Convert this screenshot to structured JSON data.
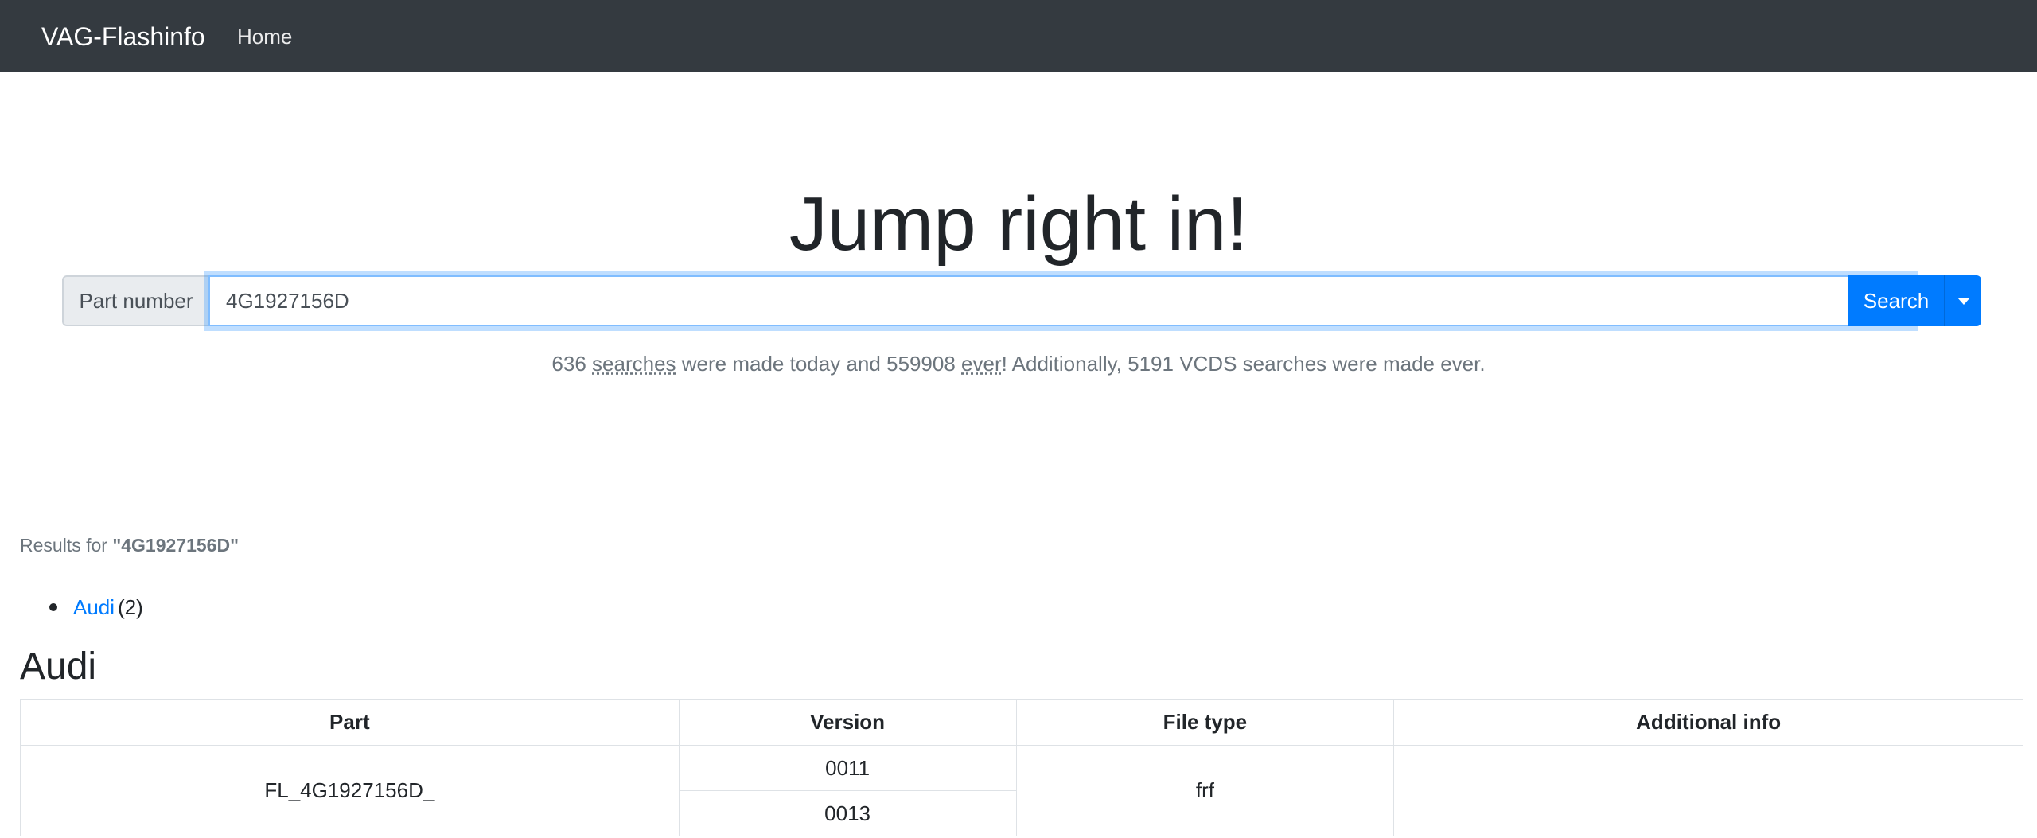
{
  "navbar": {
    "brand": "VAG-Flashinfo",
    "home_link": "Home"
  },
  "hero": {
    "title": "Jump right in!"
  },
  "search": {
    "addon_label": "Part number",
    "input_value": "4G1927156D",
    "button_label": "Search"
  },
  "stats": {
    "today_count": "636",
    "searches_word": "searches",
    "made_today_text": " were made today and ",
    "ever_count": "559908",
    "ever_word": "ever",
    "vcds_text": "! Additionally, 5191 VCDS searches were made ever."
  },
  "results": {
    "prefix": "Results for ",
    "query": "\"4G1927156D\"",
    "brands": [
      {
        "name": "Audi",
        "count": "(2)"
      }
    ]
  },
  "section": {
    "title": "Audi"
  },
  "table": {
    "headers": [
      "Part",
      "Version",
      "File type",
      "Additional info"
    ],
    "part": "FL_4G1927156D_",
    "versions": [
      "0011",
      "0013"
    ],
    "file_type": "frf",
    "additional_info": ""
  },
  "colors": {
    "navbar_bg": "#343a40",
    "primary": "#007bff",
    "muted_text": "#6c757d"
  }
}
